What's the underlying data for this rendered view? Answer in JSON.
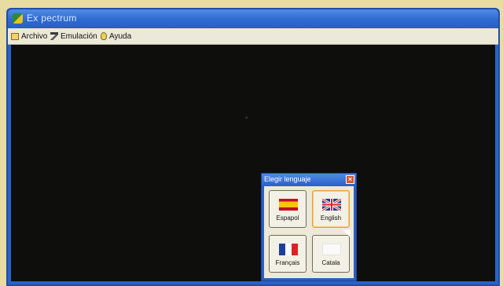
{
  "window": {
    "title": "Ex pectrum"
  },
  "menu": {
    "items": [
      {
        "label": "Archivo",
        "icon": "folder-icon"
      },
      {
        "label": "Emulación",
        "icon": "hammer-icon"
      },
      {
        "label": "Ayuda",
        "icon": "help-icon"
      }
    ]
  },
  "dialog": {
    "title": "Elegir lenguaje",
    "close_label": "×",
    "buttons": [
      {
        "label": "Espapol",
        "icon": "flag-spain-icon"
      },
      {
        "label": "English",
        "icon": "flag-uk-icon"
      },
      {
        "label": "Français",
        "icon": "flag-france-icon"
      },
      {
        "label": "Catala",
        "icon": "flag-catalonia-icon"
      }
    ]
  }
}
